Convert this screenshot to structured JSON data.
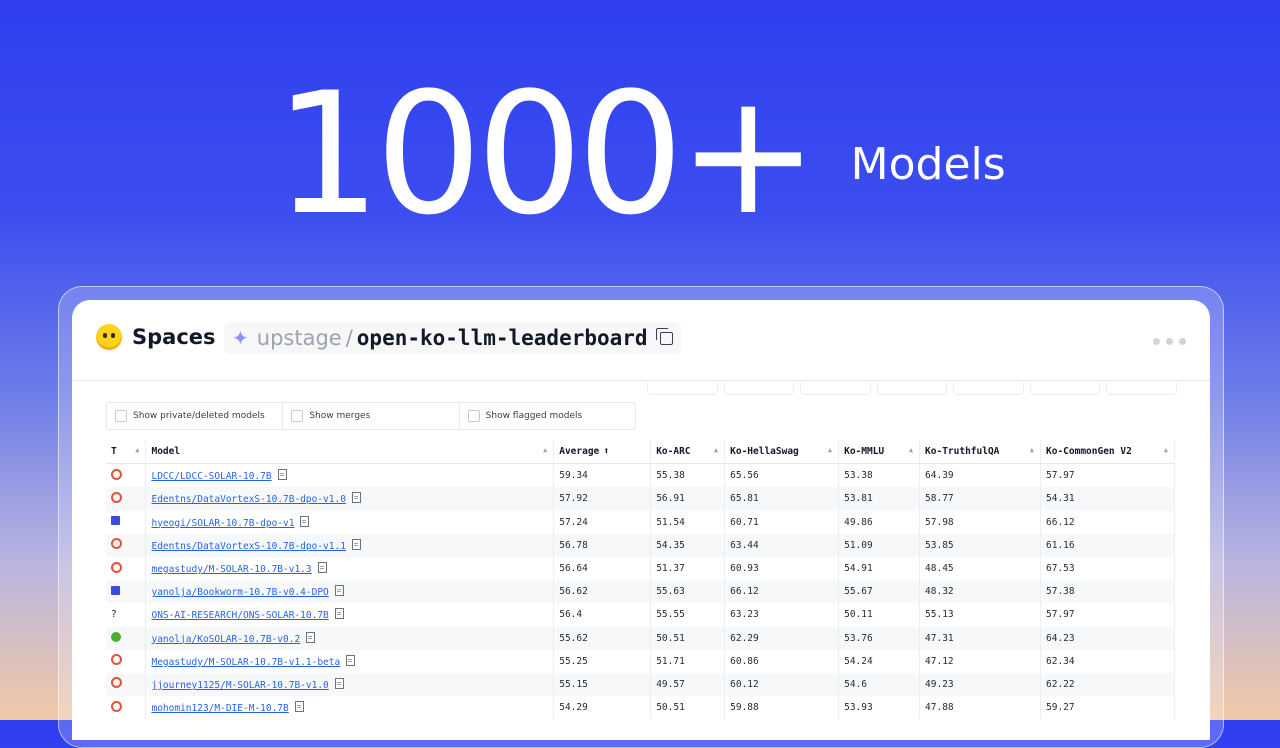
{
  "hero": {
    "number": "1000+",
    "subtitle": "Models"
  },
  "header": {
    "brand": "Spaces",
    "repo_owner": "upstage",
    "repo_separator": "/",
    "repo_name": "open-ko-llm-leaderboard"
  },
  "filters": [
    {
      "label": "Show private/deleted models",
      "checked": false
    },
    {
      "label": "Show merges",
      "checked": false
    },
    {
      "label": "Show flagged models",
      "checked": false
    }
  ],
  "table": {
    "columns": [
      "T",
      "Model",
      "Average",
      "Ko-ARC",
      "Ko-HellaSwag",
      "Ko-MMLU",
      "Ko-TruthfulQA",
      "Ko-CommonGen V2"
    ],
    "rows": [
      {
        "type": "circle",
        "model": "LDCC/LDCC-SOLAR-10.7B",
        "values": [
          "59.34",
          "55.38",
          "65.56",
          "53.38",
          "64.39",
          "57.97"
        ]
      },
      {
        "type": "circle",
        "model": "Edentns/DataVortexS-10.7B-dpo-v1.0",
        "values": [
          "57.92",
          "56.91",
          "65.81",
          "53.81",
          "58.77",
          "54.31"
        ]
      },
      {
        "type": "square",
        "model": "hyeogi/SOLAR-10.7B-dpo-v1",
        "values": [
          "57.24",
          "51.54",
          "60.71",
          "49.86",
          "57.98",
          "66.12"
        ]
      },
      {
        "type": "circle",
        "model": "Edentns/DataVortexS-10.7B-dpo-v1.1",
        "values": [
          "56.78",
          "54.35",
          "63.44",
          "51.09",
          "53.85",
          "61.16"
        ]
      },
      {
        "type": "circle",
        "model": "megastudy/M-SOLAR-10.7B-v1.3",
        "values": [
          "56.64",
          "51.37",
          "60.93",
          "54.91",
          "48.45",
          "67.53"
        ]
      },
      {
        "type": "square",
        "model": "yanolja/Bookworm-10.7B-v0.4-DPO",
        "values": [
          "56.62",
          "55.63",
          "66.12",
          "55.67",
          "48.32",
          "57.38"
        ]
      },
      {
        "type": "unknown",
        "model": "ONS-AI-RESEARCH/ONS-SOLAR-10.7B",
        "values": [
          "56.4",
          "55.55",
          "63.23",
          "50.11",
          "55.13",
          "57.97"
        ]
      },
      {
        "type": "green",
        "model": "yanolja/KoSOLAR-10.7B-v0.2",
        "values": [
          "55.62",
          "50.51",
          "62.29",
          "53.76",
          "47.31",
          "64.23"
        ]
      },
      {
        "type": "circle",
        "model": "Megastudy/M-SOLAR-10.7B-v1.1-beta",
        "values": [
          "55.25",
          "51.71",
          "60.86",
          "54.24",
          "47.12",
          "62.34"
        ]
      },
      {
        "type": "circle",
        "model": "jjourney1125/M-SOLAR-10.7B-v1.0",
        "values": [
          "55.15",
          "49.57",
          "60.12",
          "54.6",
          "49.23",
          "62.22"
        ]
      },
      {
        "type": "circle",
        "model": "mohomin123/M-DIE-M-10.7B",
        "values": [
          "54.29",
          "50.51",
          "59.88",
          "53.93",
          "47.88",
          "59.27"
        ]
      }
    ],
    "type_unknown_symbol": "?",
    "sorted_column": "Average",
    "sort_direction": "desc"
  },
  "colors": {
    "accent_blue": "#3c4ef0",
    "link": "#2563eb",
    "type_circle": "#e0553a",
    "type_square": "#3b4bd8",
    "type_green": "#4cae33"
  },
  "icons": {
    "brand": "hugging-face-icon",
    "repo": "sparkle-icon",
    "copy": "copy-icon",
    "more": "more-dots-icon",
    "doc": "model-card-icon"
  }
}
